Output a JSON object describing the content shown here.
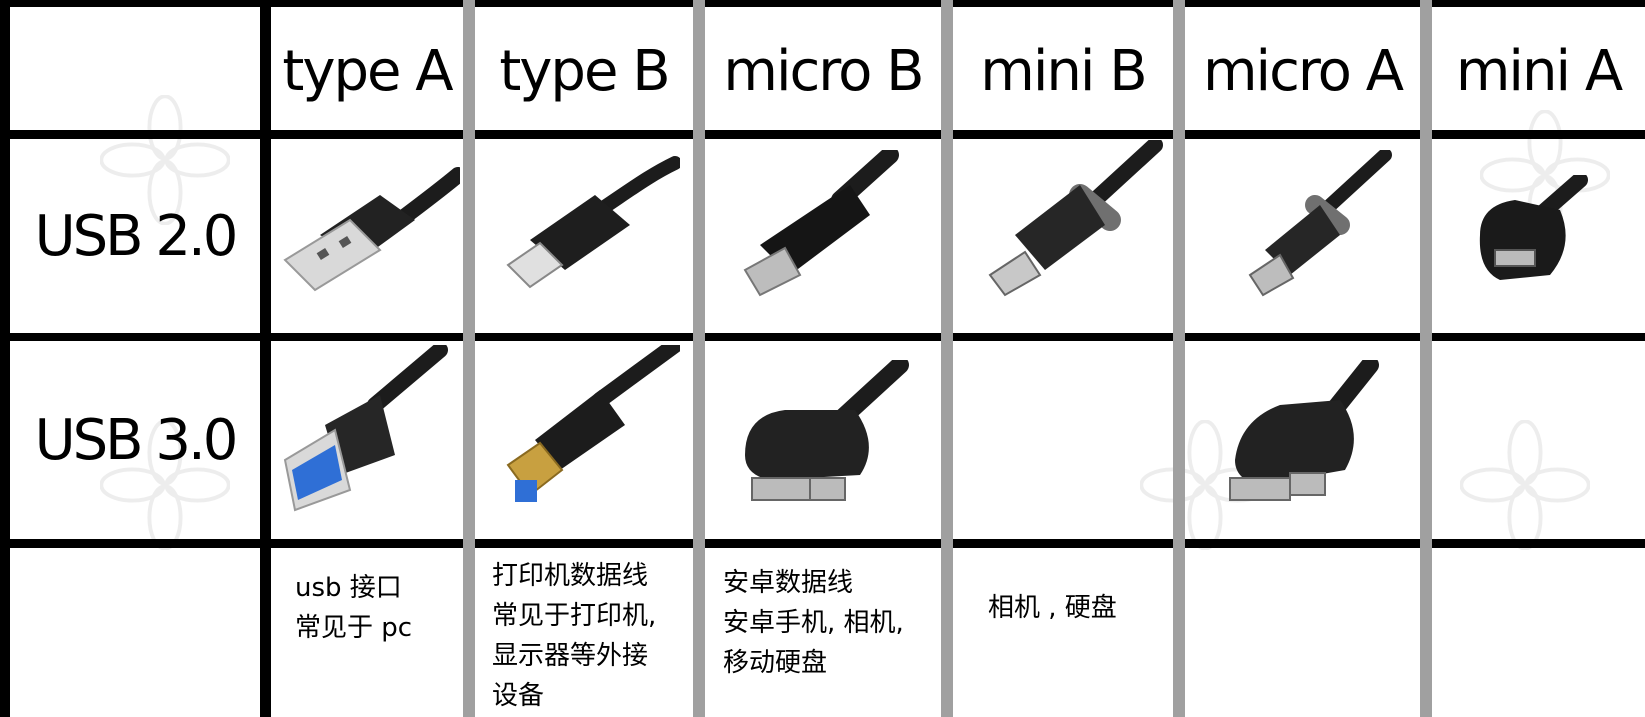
{
  "headers": [
    "type A",
    "type B",
    "micro B",
    "mini B",
    "micro A",
    "mini A"
  ],
  "rows": [
    "USB 2.0",
    "USB 3.0"
  ],
  "notes": {
    "type_a": [
      "usb 接口",
      "常见于 pc"
    ],
    "type_b": [
      "打印机数据线",
      "常见于打印机,",
      "显示器等外接",
      "设备"
    ],
    "micro_b": [
      "安卓数据线",
      "安卓手机, 相机,",
      "移动硬盘"
    ],
    "mini_b": [
      "相机 , 硬盘"
    ]
  },
  "cells": {
    "usb2": [
      "usb2-type-a-connector",
      "usb2-type-b-connector",
      "usb2-micro-b-connector",
      "usb2-mini-b-connector",
      "usb2-micro-a-connector",
      "usb2-mini-a-connector"
    ],
    "usb3": [
      "usb3-type-a-connector",
      "usb3-type-b-connector",
      "usb3-micro-b-connector",
      "",
      "usb3-micro-a-connector",
      ""
    ]
  },
  "colors": {
    "grid_black": "#000000",
    "grid_gray": "#a0a0a0",
    "usb3_blue": "#2f6fd6",
    "gold": "#c8a040",
    "plug_black": "#1c1c1c"
  }
}
